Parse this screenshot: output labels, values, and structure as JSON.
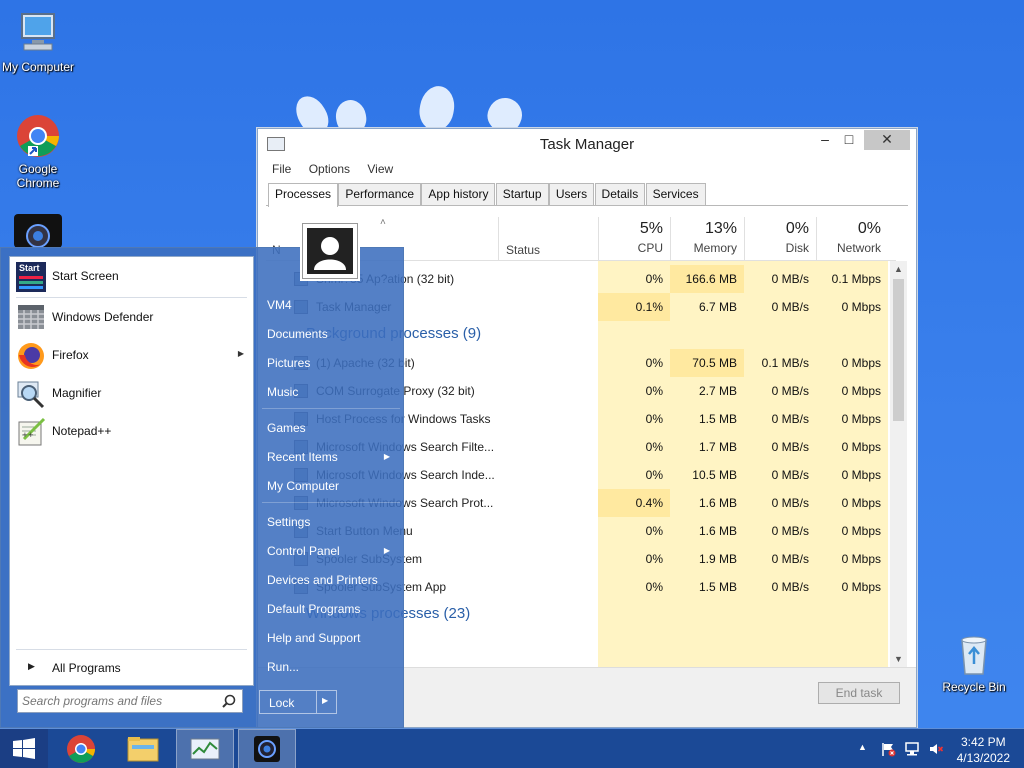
{
  "desktop": {
    "icons": [
      {
        "label": "My Computer"
      },
      {
        "label": "Google Chrome"
      },
      {
        "label": "Recycle Bin"
      }
    ]
  },
  "task_manager": {
    "title": "Task Manager",
    "menu": [
      "File",
      "Options",
      "View"
    ],
    "tabs": [
      "Processes",
      "Performance",
      "App history",
      "Startup",
      "Users",
      "Details",
      "Services"
    ],
    "active_tab": "Processes",
    "columns": {
      "name": "N",
      "status": "Status",
      "cpu_pct": "5%",
      "cpu": "CPU",
      "mem_pct": "13%",
      "mem": "Memory",
      "disk_pct": "0%",
      "disk": "Disk",
      "net_pct": "0%",
      "net": "Network"
    },
    "rows": [
      {
        "type": "proc",
        "name": "Snmi?35 Ap?ation (32 bit)",
        "cpu": "0%",
        "mem": "166.6 MB",
        "disk": "0 MB/s",
        "net": "0.1 Mbps"
      },
      {
        "type": "proc",
        "name": "Task Manager",
        "cpu": "0.1%",
        "mem": "6.7 MB",
        "disk": "0 MB/s",
        "net": "0 Mbps"
      },
      {
        "type": "group",
        "name": "Background processes (9)"
      },
      {
        "type": "proc",
        "name": "(1) Apache (32 bit)",
        "cpu": "0%",
        "mem": "70.5 MB",
        "disk": "0.1 MB/s",
        "net": "0 Mbps"
      },
      {
        "type": "proc",
        "name": "COM Surrogate Proxy (32 bit)",
        "cpu": "0%",
        "mem": "2.7 MB",
        "disk": "0 MB/s",
        "net": "0 Mbps"
      },
      {
        "type": "proc",
        "name": "Host Process for Windows Tasks",
        "cpu": "0%",
        "mem": "1.5 MB",
        "disk": "0 MB/s",
        "net": "0 Mbps"
      },
      {
        "type": "proc",
        "name": "Microsoft Windows Search Filte...",
        "cpu": "0%",
        "mem": "1.7 MB",
        "disk": "0 MB/s",
        "net": "0 Mbps"
      },
      {
        "type": "proc",
        "name": "Microsoft Windows Search Inde...",
        "cpu": "0%",
        "mem": "10.5 MB",
        "disk": "0 MB/s",
        "net": "0 Mbps"
      },
      {
        "type": "proc",
        "name": "Microsoft Windows Search Prot...",
        "cpu": "0.4%",
        "mem": "1.6 MB",
        "disk": "0 MB/s",
        "net": "0 Mbps"
      },
      {
        "type": "proc",
        "name": "Start Button Menu",
        "cpu": "0%",
        "mem": "1.6 MB",
        "disk": "0 MB/s",
        "net": "0 Mbps"
      },
      {
        "type": "proc",
        "name": "Spooler SubSystem",
        "cpu": "0%",
        "mem": "1.9 MB",
        "disk": "0 MB/s",
        "net": "0 Mbps"
      },
      {
        "type": "proc",
        "name": "Spooler SubSystem App",
        "cpu": "0%",
        "mem": "1.5 MB",
        "disk": "0 MB/s",
        "net": "0 Mbps"
      },
      {
        "type": "group",
        "name": "Windows processes (23)"
      }
    ],
    "end_task": "End task"
  },
  "start_menu": {
    "left_items": [
      {
        "label": "Start Screen",
        "icon": "start-screen-icon"
      },
      {
        "label": "Windows Defender",
        "icon": "windows-defender-icon"
      },
      {
        "label": "Firefox",
        "icon": "firefox-icon",
        "arrow": true
      },
      {
        "label": "Magnifier",
        "icon": "magnifier-icon"
      },
      {
        "label": "Notepad++",
        "icon": "notepad-plus-plus-icon"
      }
    ],
    "start_icon_text": "Start",
    "all_programs": "All Programs",
    "search_placeholder": "Search programs and files",
    "right_items": [
      "VM4",
      "Documents",
      "Pictures",
      "Music",
      "Games",
      "Recent Items",
      "My Computer",
      "Settings",
      "Control Panel",
      "Devices and Printers",
      "Default Programs",
      "Help and Support",
      "Run..."
    ],
    "lock": "Lock"
  },
  "taskbar": {
    "time": "3:42 PM",
    "date": "4/13/2022"
  }
}
